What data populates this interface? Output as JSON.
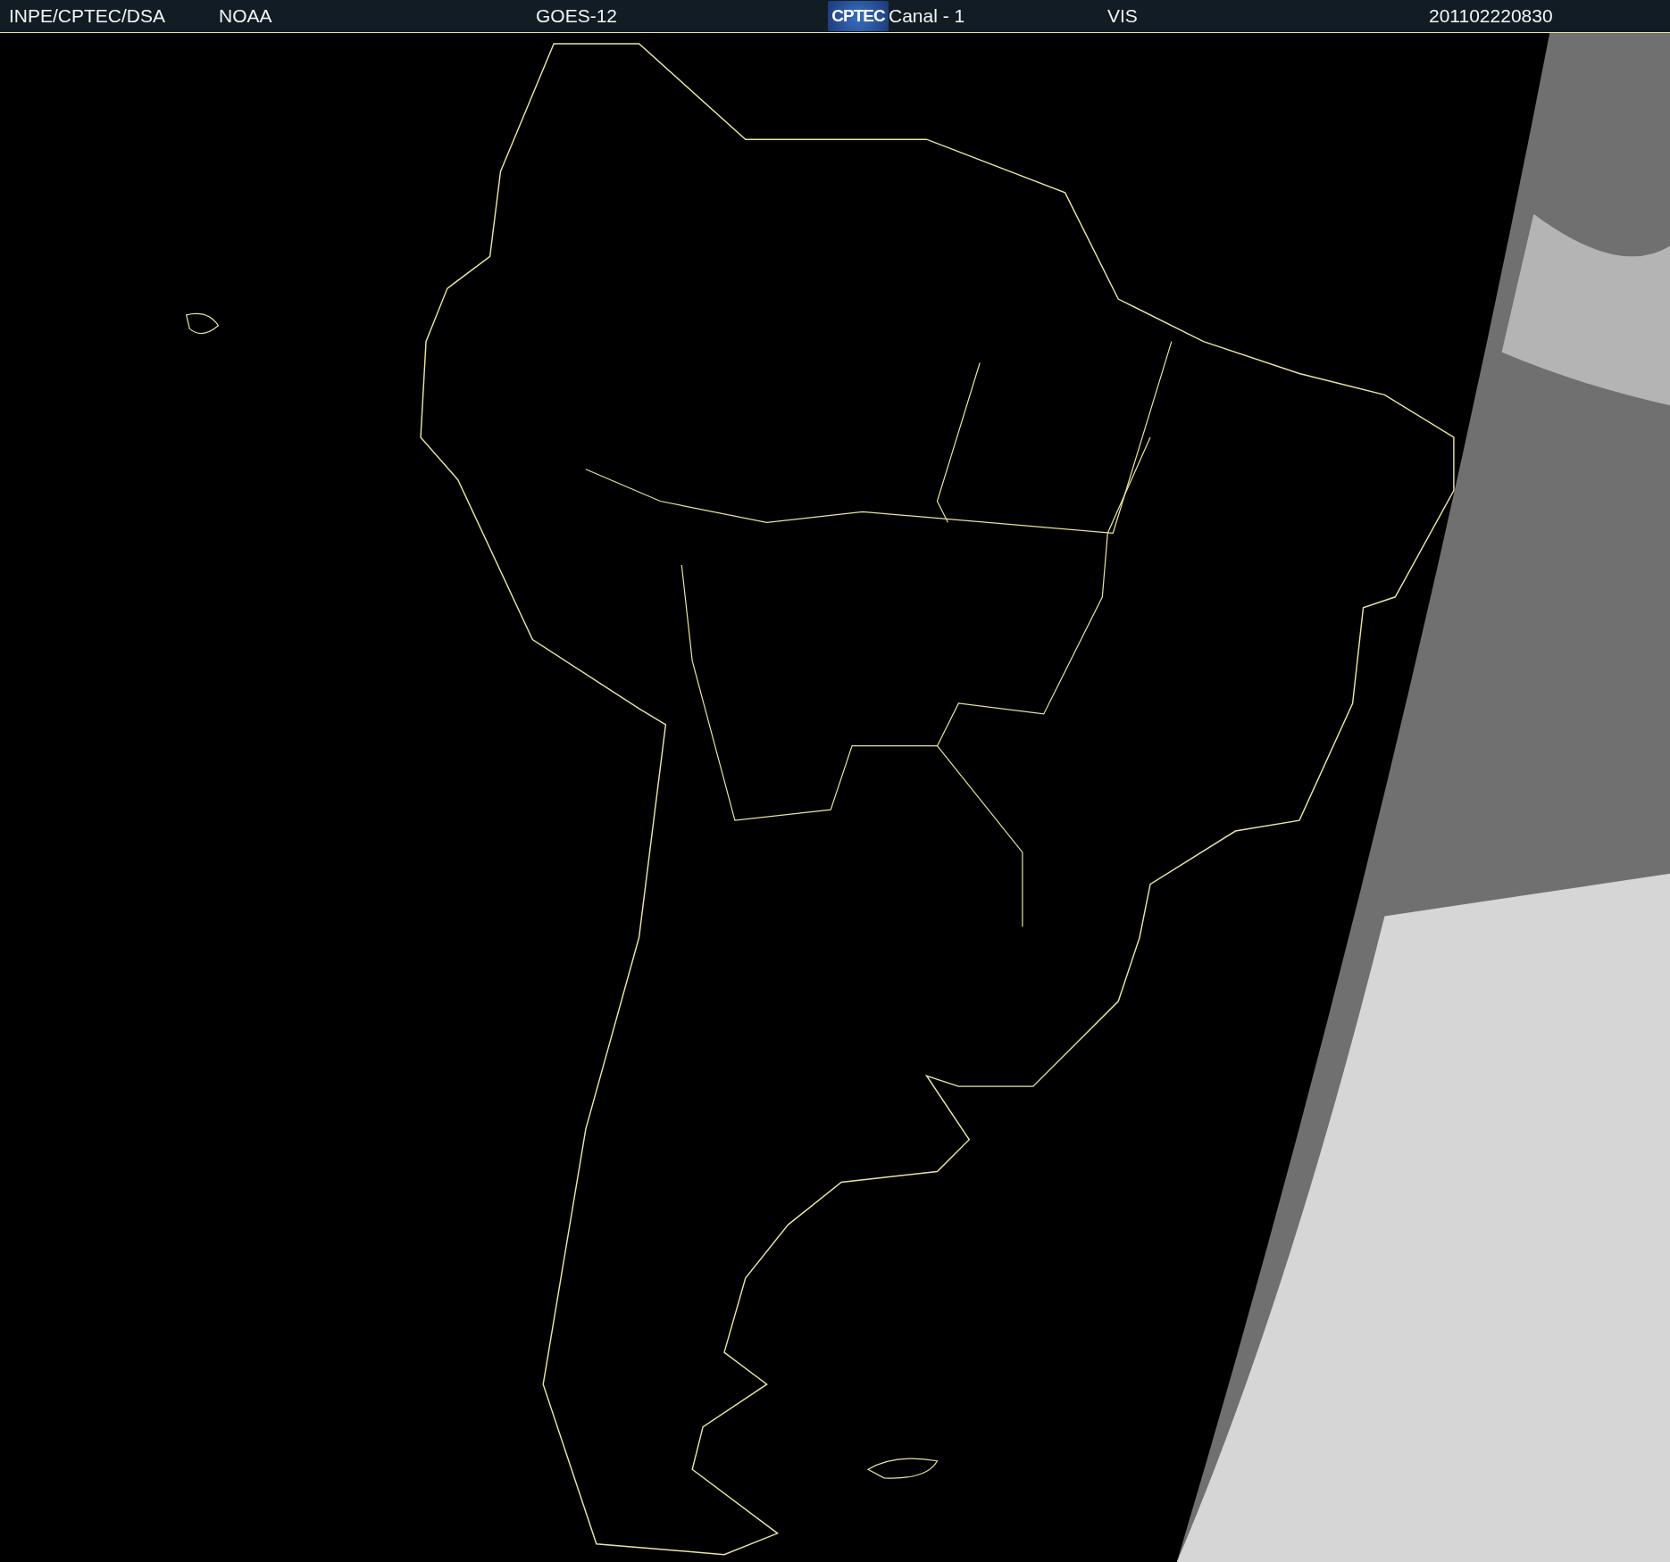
{
  "header": {
    "items": [
      {
        "kind": "text",
        "text": "INPE/CPTEC/DSA"
      },
      {
        "kind": "text",
        "text": "NOAA"
      },
      {
        "kind": "text",
        "text": "GOES-12"
      },
      {
        "kind": "logo",
        "text": "CPTEC"
      },
      {
        "kind": "text",
        "text": "Canal - 1"
      },
      {
        "kind": "text",
        "text": "VIS"
      },
      {
        "kind": "text",
        "text": "201102220830"
      }
    ]
  }
}
